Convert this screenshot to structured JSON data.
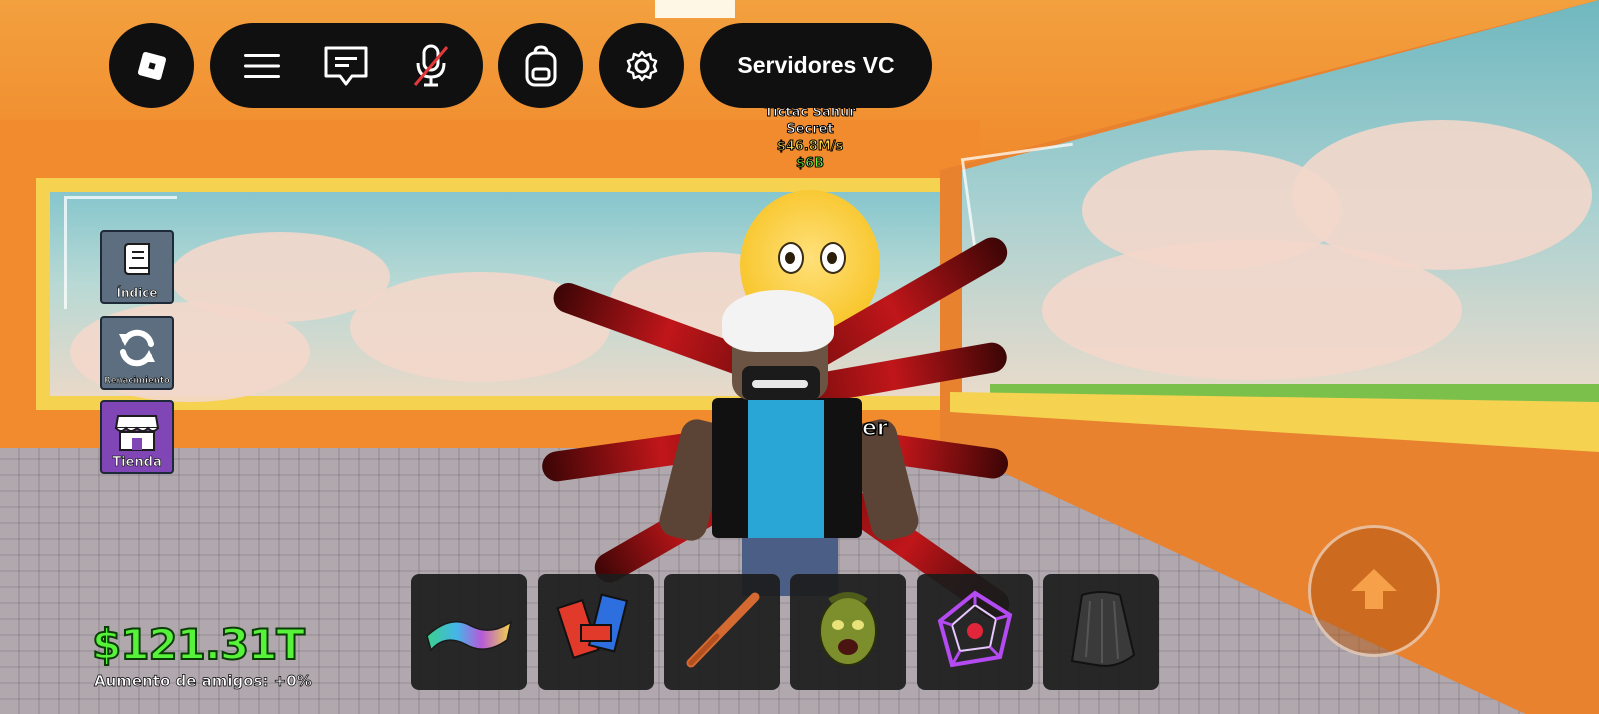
{
  "hud": {
    "topbar": {
      "roblox_menu_icon": "roblox-logo-icon",
      "menu_icon": "hamburger-menu-icon",
      "chat_icon": "chat-icon",
      "mic_icon": "microphone-muted-icon",
      "backpack_icon": "backpack-icon",
      "settings_icon": "gear-icon",
      "servers_label": "Servidores VC"
    },
    "side_menu": [
      {
        "label": "Índice",
        "icon": "book-icon",
        "color": "#5c6e7f"
      },
      {
        "label": "Renacimiento",
        "icon": "refresh-icon",
        "color": "#5c6e7f"
      },
      {
        "label": "Tienda",
        "icon": "shop-icon",
        "color": "#8046b5"
      }
    ],
    "money": "$121.31T",
    "friends_boost": "Aumento de amigos: +0%",
    "hotbar": [
      {
        "icon": "magic-carpet-icon"
      },
      {
        "icon": "blocks-tool-icon"
      },
      {
        "icon": "baseball-bat-icon"
      },
      {
        "icon": "zombie-head-icon"
      },
      {
        "icon": "cage-trap-icon"
      },
      {
        "icon": "cloak-icon"
      }
    ],
    "jump_icon": "jump-arrow-icon"
  },
  "world": {
    "brainrot_name": "Tictac Sahur",
    "brainrot_rarity": "Secret",
    "brainrot_rate": "$46.8M/s",
    "brainrot_price": "$6B",
    "partial_label": "er"
  },
  "colors": {
    "money_green": "#57f23a",
    "hud_black": "#101010",
    "wall_orange": "#f18b2d",
    "frame_yellow": "#f6d251"
  }
}
